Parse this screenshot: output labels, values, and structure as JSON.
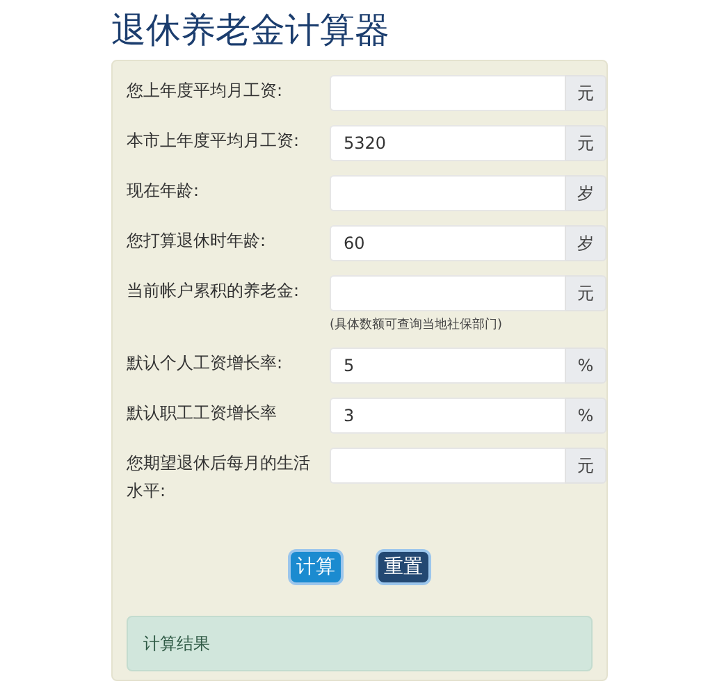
{
  "title": "退休养老金计算器",
  "fields": [
    {
      "label": "您上年度平均月工资:",
      "unit": "元"
    },
    {
      "label": "本市上年度平均月工资:",
      "value": "5320",
      "unit": "元"
    },
    {
      "label": "现在年龄:",
      "unit": "岁"
    },
    {
      "label": "您打算退休时年龄:",
      "value": "60",
      "unit": "岁"
    },
    {
      "label": "当前帐户累积的养老金:",
      "unit": "元",
      "hint": "(具体数额可查询当地社保部门)"
    },
    {
      "label": "默认个人工资增长率:",
      "value": "5",
      "unit": "%"
    },
    {
      "label": "默认职工工资增长率",
      "value": "3",
      "unit": "%"
    },
    {
      "label": "您期望退休后每月的生活水平:",
      "unit": "元"
    }
  ],
  "buttons": [
    {
      "label": "计算",
      "kind": "primary"
    },
    {
      "label": "重置",
      "kind": "reset"
    }
  ],
  "result": {
    "label": "计算结果"
  }
}
